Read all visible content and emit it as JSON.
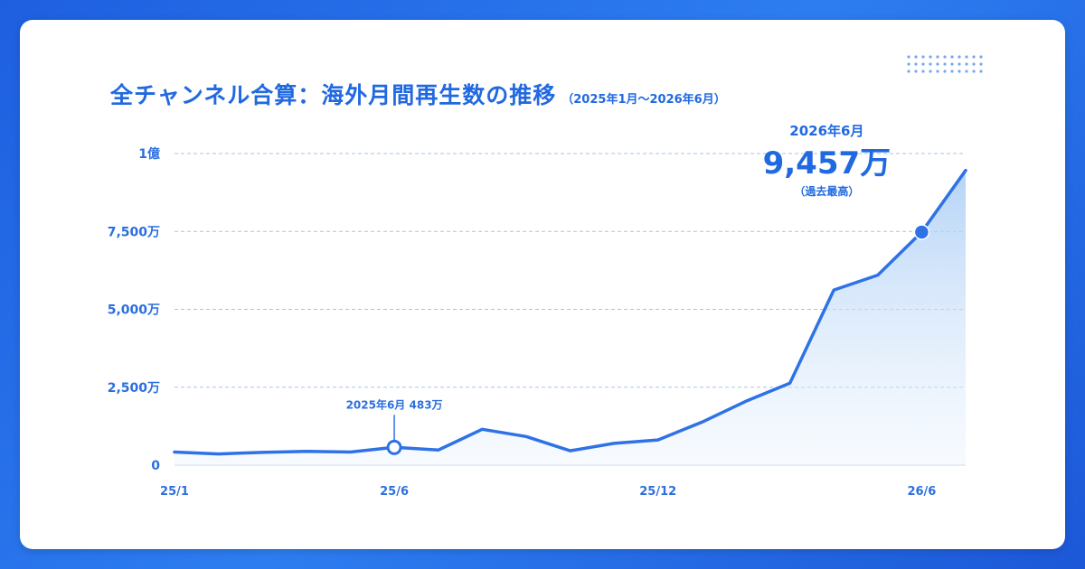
{
  "title": "全チャンネル合算：海外月間再生数の推移",
  "subtitle": "（2025年1月〜2026年6月）",
  "colors": {
    "line": "#2e72e6",
    "accent": "#2169e0",
    "grid": "#a9c2ea",
    "background": "#2272e8"
  },
  "chart_data": {
    "type": "area",
    "title": "全チャンネル合算：海外月間再生数の推移",
    "x": [
      "2025-01",
      "2025-02",
      "2025-03",
      "2025-04",
      "2025-05",
      "2025-06",
      "2025-07",
      "2025-08",
      "2025-09",
      "2025-10",
      "2025-11",
      "2025-12",
      "2026-01",
      "2026-02",
      "2026-03",
      "2026-04",
      "2026-05",
      "2026-06"
    ],
    "x_ticks": [
      {
        "index": 0,
        "label": "25/1"
      },
      {
        "index": 5,
        "label": "25/6"
      },
      {
        "index": 11,
        "label": "25/12"
      },
      {
        "index": 17,
        "label": "26/6"
      }
    ],
    "y_ticks": [
      {
        "value": 0,
        "label": "0"
      },
      {
        "value": 25000000,
        "label": "2,500万"
      },
      {
        "value": 50000000,
        "label": "5,000万"
      },
      {
        "value": 75000000,
        "label": "7,500万"
      },
      {
        "value": 100000000,
        "label": "1億"
      }
    ],
    "series": [
      {
        "values": [
          4200000,
          3600000,
          4100000,
          4400000,
          4200000,
          5700000,
          4830000,
          11500000,
          9200000,
          4600000,
          7000000,
          8100000,
          13800000,
          20500000,
          26300000,
          56200000,
          61000000,
          74800000,
          94570000
        ]
      }
    ],
    "ylim": [
      0,
      100000000
    ],
    "grid": true,
    "annotations": [
      {
        "index": 5,
        "date": "2025年6月",
        "value_label": "483万",
        "marker": "hollow"
      },
      {
        "index": 17,
        "date": "2026年6月",
        "value_label": "9,457万",
        "note": "（過去最高）",
        "marker": "filled"
      }
    ]
  }
}
